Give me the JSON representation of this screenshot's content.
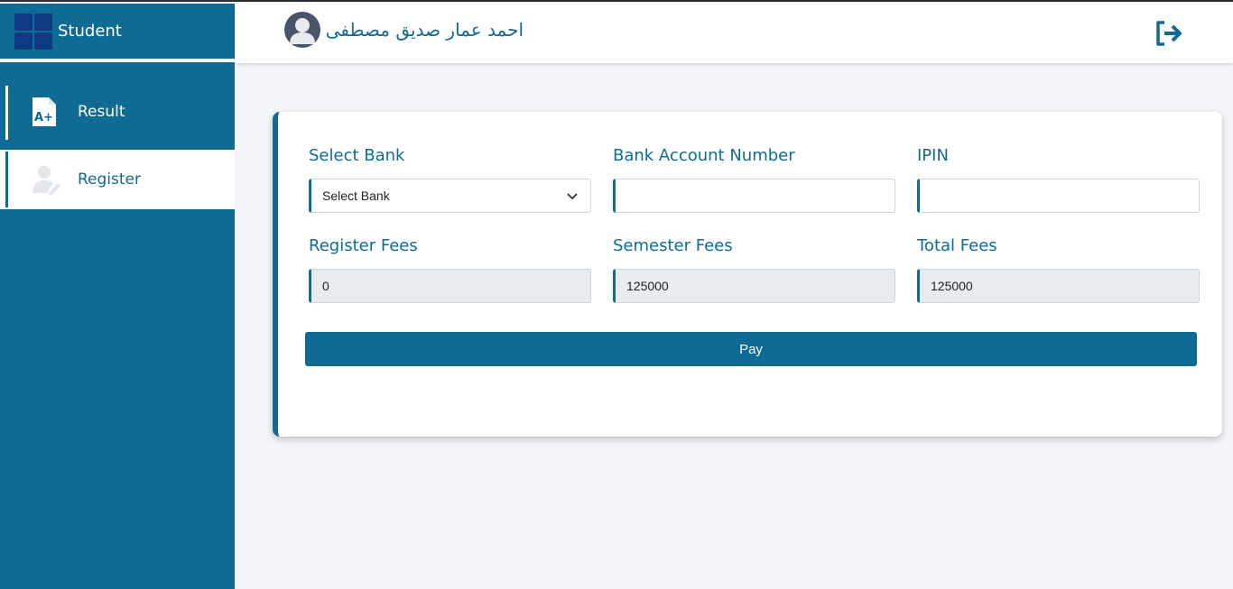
{
  "sidebar": {
    "brand": "Student",
    "items": [
      {
        "label": "Result",
        "icon": "grade-document-icon"
      },
      {
        "label": "Register",
        "icon": "user-edit-icon"
      }
    ]
  },
  "header": {
    "user_name": "احمد عمار صديق مصطفى",
    "logout_icon": "logout-icon"
  },
  "form": {
    "select_bank_label": "Select Bank",
    "select_bank_value": "Select Bank",
    "account_label": "Bank Account Number",
    "account_value": "",
    "ipin_label": "IPIN",
    "ipin_value": "",
    "register_fees_label": "Register Fees",
    "register_fees_value": "0",
    "semester_fees_label": "Semester Fees",
    "semester_fees_value": "125000",
    "total_fees_label": "Total Fees",
    "total_fees_value": "125000",
    "pay_label": "Pay"
  },
  "colors": {
    "primary": "#0f6a94",
    "background": "#f4f5f8",
    "readonly": "#e9ecef"
  }
}
